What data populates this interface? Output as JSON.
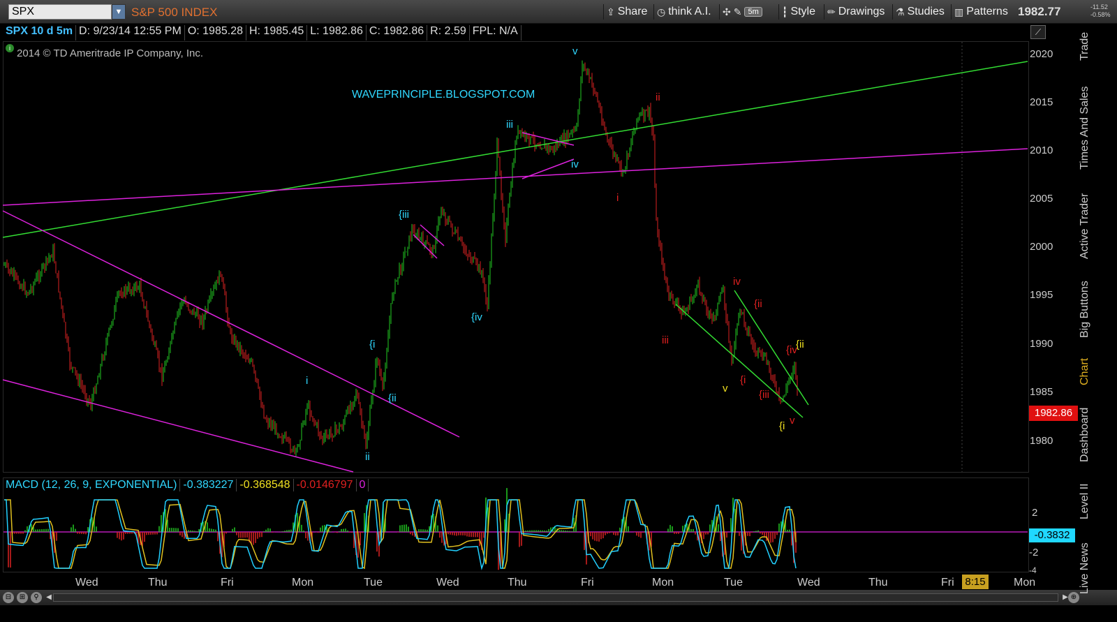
{
  "header": {
    "symbol": "SPX",
    "symbol_name": "S&P 500 INDEX",
    "share_label": "Share",
    "think_label": "think A.I.",
    "interval_badge": "5m",
    "style_label": "Style",
    "drawings_label": "Drawings",
    "studies_label": "Studies",
    "patterns_label": "Patterns",
    "last_price": "1982.77",
    "change_abs": "-11.52",
    "change_pct": "-0.58%"
  },
  "infobar": {
    "study": "SPX 10 d 5m",
    "date": "D: 9/23/14 12:55 PM",
    "open": "O: 1985.28",
    "high": "H: 1985.45",
    "low": "L: 1982.86",
    "close": "C: 1982.86",
    "range": "R: 2.59",
    "fpl": "FPL: N/A"
  },
  "copyright": "2014 © TD Ameritrade IP Company, Inc.",
  "watermark": "WAVEPRINCIPLE.BLOGSPOT.COM",
  "macd": {
    "title": "MACD (12, 26, 9, EXPONENTIAL)",
    "value": "-0.383227",
    "avg": "-0.368548",
    "diff": "-0.0146797",
    "zero": "0",
    "tag": "-0.3832",
    "y_labels": [
      "2",
      "-2",
      "-4"
    ]
  },
  "price_axis": {
    "labels": [
      "2020",
      "2015",
      "2010",
      "2005",
      "2000",
      "1995",
      "1990",
      "1985",
      "1980"
    ],
    "current_tag": "1982.86"
  },
  "time_axis": {
    "labels": [
      "Wed",
      "Thu",
      "Fri",
      "Mon",
      "Tue",
      "Wed",
      "Thu",
      "Fri",
      "Mon",
      "Tue",
      "Wed",
      "Thu",
      "Fri",
      "Mon"
    ],
    "time_tag": "8:15"
  },
  "side_tabs": [
    "Trade",
    "Times And Sales",
    "Active Trader",
    "Big Buttons",
    "Chart",
    "Dashboard",
    "Level II",
    "Live News"
  ],
  "wave_labels": {
    "cyan": [
      "v",
      "iii",
      "iv",
      "{iii",
      "{iv",
      "{i",
      "{ii",
      "i",
      "ii"
    ],
    "red": [
      "ii",
      "i",
      "iii",
      "iv",
      "{ii",
      "{i",
      "{iii",
      "{iv",
      "v"
    ],
    "yellow": [
      "v",
      "{ii",
      "{i"
    ]
  },
  "colors": {
    "up": "#22cc22",
    "down": "#dd2222",
    "green_line": "#33dd33",
    "magenta_line": "#dd22dd",
    "macd": "#22d0ff",
    "avg": "#e0c020",
    "cyan_label": "#30d8ff",
    "red_label": "#e02020",
    "yellow_label": "#f0e020"
  }
}
